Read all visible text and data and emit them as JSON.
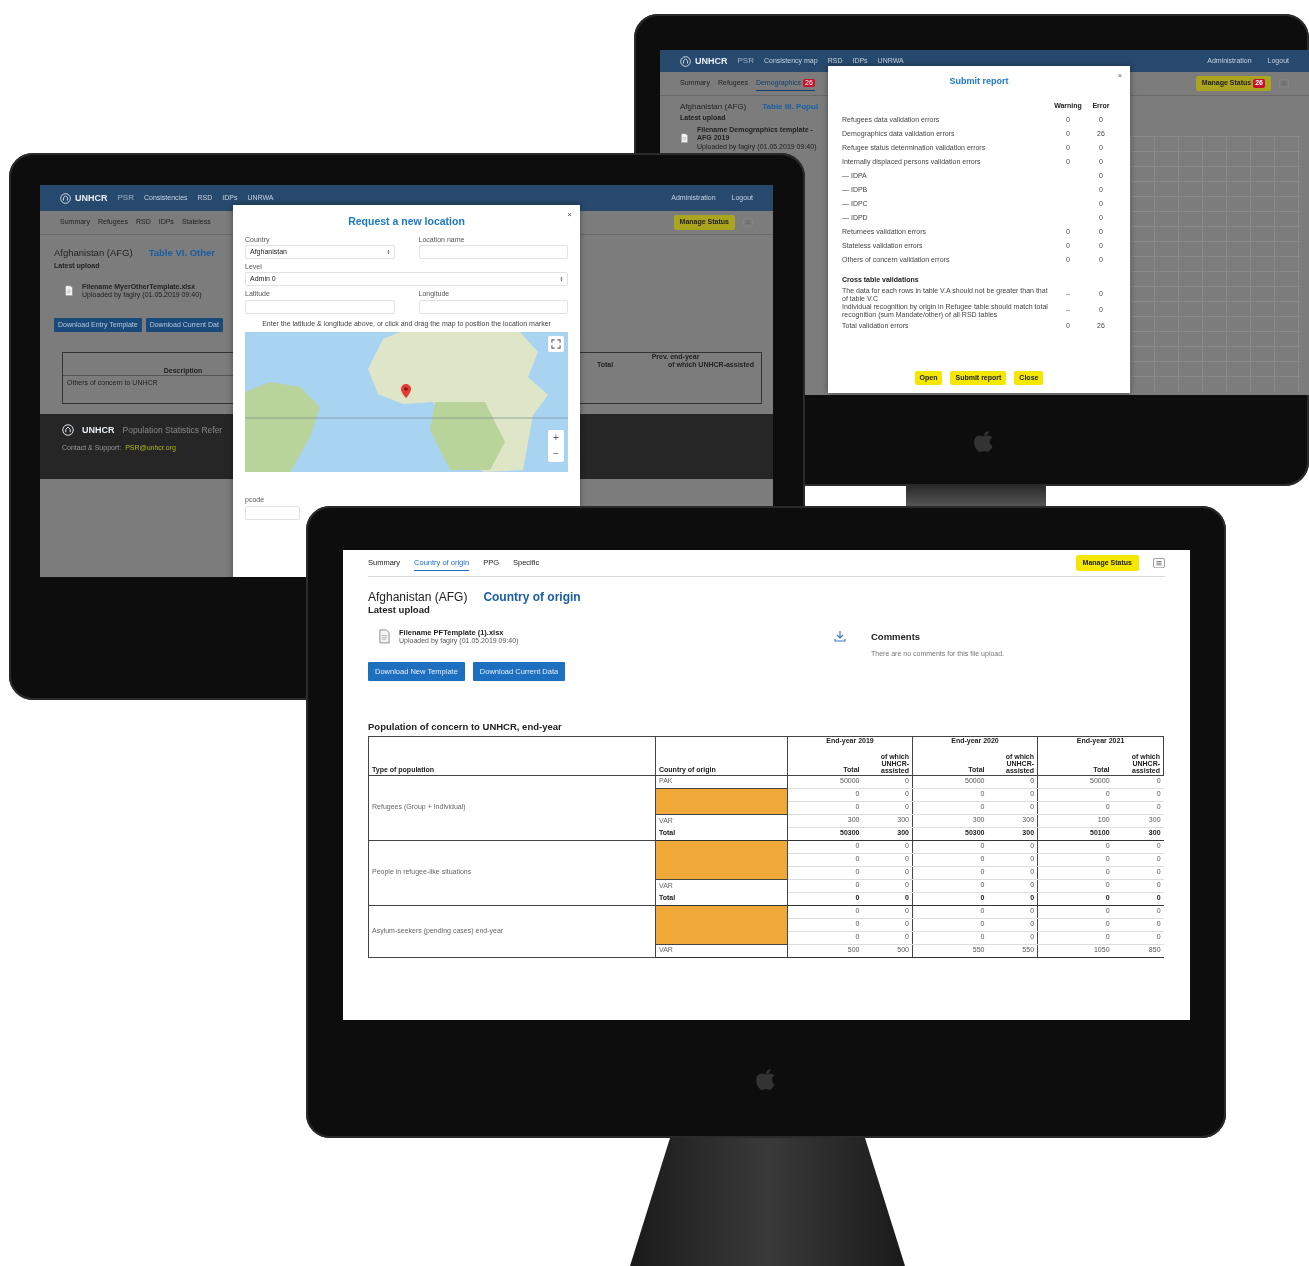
{
  "report_screen": {
    "header": {
      "logo": "UNHCR",
      "app": "PSR",
      "nav": [
        "Consistency map",
        "RSD",
        "IDPs",
        "UNRWA"
      ],
      "right": [
        "Administration",
        "Logout"
      ]
    },
    "tabs": [
      {
        "label": "Summary",
        "selected": false
      },
      {
        "label": "Refugees",
        "selected": false
      },
      {
        "label": "Demographics",
        "selected": true,
        "badge": "26"
      }
    ],
    "manage_button": {
      "label": "Manage Status",
      "badge": "26"
    },
    "title": "Afghanistan (AFG)",
    "subtitle": "Table III. Popul",
    "latest_upload": "Latest upload",
    "file": {
      "name": "Filename Demographics template - AFG 2019",
      "meta": "Uploaded by fagiry (01.05.2019 09:40)"
    },
    "modal": {
      "title": "Submit report",
      "close": "×",
      "columns": [
        "Warning",
        "Error"
      ],
      "rows": [
        {
          "label": "Refugees data validation errors",
          "warning": "0",
          "error": "0"
        },
        {
          "label": "Demographics data validation errors",
          "warning": "0",
          "error": "26"
        },
        {
          "label": "Refugee status determination validation errors",
          "warning": "0",
          "error": "0"
        },
        {
          "label": "Internally displaced persons validation errors",
          "warning": "0",
          "error": "0"
        },
        {
          "label": "— IDPA",
          "error": "0"
        },
        {
          "label": "— IDPB",
          "error": "0"
        },
        {
          "label": "— IDPC",
          "error": "0"
        },
        {
          "label": "— IDPD",
          "error": "0"
        },
        {
          "label": "Returnees validation errors",
          "warning": "0",
          "error": "0"
        },
        {
          "label": "Stateless validation errors",
          "warning": "0",
          "error": "0"
        },
        {
          "label": "Others of concern validation errors",
          "warning": "0",
          "error": "0"
        }
      ],
      "cross_heading": "Cross table validations",
      "cross_rows": [
        {
          "label": "The data for each rows in table V.A should not be greater than that of table V.C",
          "warning": "–",
          "error": "0"
        },
        {
          "label": "Individual recognition by origin in Refugee table should match total recognition (sum Mandate/other) of all RSD tables",
          "warning": "–",
          "error": "0"
        }
      ],
      "total": {
        "label": "Total validation errors",
        "warning": "0",
        "error": "26"
      },
      "buttons": [
        "Open",
        "Submit report",
        "Close"
      ]
    }
  },
  "location_screen": {
    "header": {
      "logo": "UNHCR",
      "app": "PSR",
      "nav": [
        "Consistencies",
        "RSD",
        "IDPs",
        "UNRWA"
      ],
      "right": [
        "Administration",
        "Logout"
      ]
    },
    "tabs": [
      {
        "label": "Summary",
        "selected": false
      },
      {
        "label": "Refugees",
        "selected": false
      },
      {
        "label": "RSD",
        "selected": false
      },
      {
        "label": "IDPs",
        "selected": false
      },
      {
        "label": "Stateless",
        "selected": false
      }
    ],
    "manage_button": {
      "label": "Manage Status"
    },
    "title": "Afghanistan (AFG)",
    "subtitle": "Table VI. Other",
    "latest_upload": "Latest upload",
    "file": {
      "name": "Filename MyerOtherTemplate.xlsx",
      "meta": "Uploaded by fagiry (01.05.2019 09:40)"
    },
    "buttons": [
      "Download Entry Template",
      "Download Current Dat"
    ],
    "table": {
      "description_header": "Description",
      "group_header": "Prev. end-year",
      "columns": [
        "Total",
        "of which UNHCR-assisted"
      ],
      "rows": [
        "Others of concern to UNHCR"
      ]
    },
    "footer": {
      "logo": "UNHCR",
      "title": "Population Statistics Refer",
      "contact": "Contact & Support:",
      "email": "PSR@unhcr.org"
    },
    "modal": {
      "title": "Request a new location",
      "close": "×",
      "field_rows": [
        [
          {
            "label": "Country",
            "kind": "select",
            "value": "Afghanistan"
          },
          {
            "label": "Location name",
            "kind": "text"
          }
        ],
        [
          {
            "label": "Level",
            "kind": "select",
            "value": "Admin 0"
          }
        ],
        [
          {
            "label": "Latitude",
            "kind": "text"
          },
          {
            "label": "Longitude",
            "kind": "text"
          }
        ]
      ],
      "hint": "Enter the latitude & longitude above, or click and drag the map to position the location marker",
      "zoom_in": "+",
      "zoom_out": "−",
      "pcode_label": "pcode"
    }
  },
  "upload_screen": {
    "tabs": [
      {
        "label": "Summary",
        "selected": false
      },
      {
        "label": "Country of origin",
        "selected": true
      },
      {
        "label": "PPG",
        "selected": false
      },
      {
        "label": "Specific",
        "selected": false
      }
    ],
    "manage_button": {
      "label": "Manage Status"
    },
    "title": "Afghanistan (AFG)",
    "subtitle": "Country of origin",
    "latest_upload": "Latest upload",
    "file": {
      "name": "Filename PFTemplate (1).xlsx",
      "meta": "Uploaded by fagiry (01.05.2019 09:40)"
    },
    "buttons": [
      "Download New Template",
      "Download Current Data"
    ],
    "comments": {
      "title": "Comments",
      "text": "There are no comments for this file upload."
    },
    "table": {
      "title": "Population of concern to UNHCR, end-year",
      "type_header": "Type of population",
      "origin_header": "Country of origin",
      "years": [
        {
          "label": "End-year 2019",
          "sub_headers": [
            "Total",
            "of which UNHCR-assisted"
          ]
        },
        {
          "label": "End-year 2020",
          "sub_headers": [
            "Total",
            "of which UNHCR-assisted"
          ]
        },
        {
          "label": "End-year 2021",
          "sub_headers": [
            "Total",
            "of which UNHCR-assisted"
          ]
        }
      ],
      "groups": [
        {
          "type": "Refugees (Group + Individual)",
          "rows": [
            {
              "kind": "origin",
              "origin": "PAK",
              "values": [
                "50000",
                "0",
                "50000",
                "0",
                "50000",
                "0"
              ]
            },
            {
              "kind": "flagged",
              "values": [
                "0",
                "0",
                "0",
                "0",
                "0",
                "0"
              ]
            },
            {
              "kind": "flagged",
              "values": [
                "0",
                "0",
                "0",
                "0",
                "0",
                "0"
              ]
            },
            {
              "kind": "origin",
              "origin": "VAR",
              "values": [
                "300",
                "300",
                "300",
                "300",
                "100",
                "300"
              ]
            },
            {
              "kind": "total",
              "origin": "Total",
              "values": [
                "50300",
                "300",
                "50300",
                "300",
                "50100",
                "300"
              ]
            }
          ]
        },
        {
          "type": "People in refugee-like situations",
          "rows": [
            {
              "kind": "flagged",
              "values": [
                "0",
                "0",
                "0",
                "0",
                "0",
                "0"
              ]
            },
            {
              "kind": "flagged",
              "values": [
                "0",
                "0",
                "0",
                "0",
                "0",
                "0"
              ]
            },
            {
              "kind": "flagged",
              "values": [
                "0",
                "0",
                "0",
                "0",
                "0",
                "0"
              ]
            },
            {
              "kind": "origin",
              "origin": "VAR",
              "values": [
                "0",
                "0",
                "0",
                "0",
                "0",
                "0"
              ]
            },
            {
              "kind": "total",
              "origin": "Total",
              "values": [
                "0",
                "0",
                "0",
                "0",
                "0",
                "0"
              ]
            }
          ]
        },
        {
          "type": "Asylum-seekers (pending cases) end-year",
          "rows": [
            {
              "kind": "flagged",
              "values": [
                "0",
                "0",
                "0",
                "0",
                "0",
                "0"
              ]
            },
            {
              "kind": "flagged",
              "values": [
                "0",
                "0",
                "0",
                "0",
                "0",
                "0"
              ]
            },
            {
              "kind": "flagged",
              "values": [
                "0",
                "0",
                "0",
                "0",
                "0",
                "0"
              ]
            },
            {
              "kind": "origin",
              "origin": "VAR",
              "values": [
                "500",
                "500",
                "550",
                "550",
                "1050",
                "850"
              ]
            }
          ]
        }
      ]
    }
  }
}
